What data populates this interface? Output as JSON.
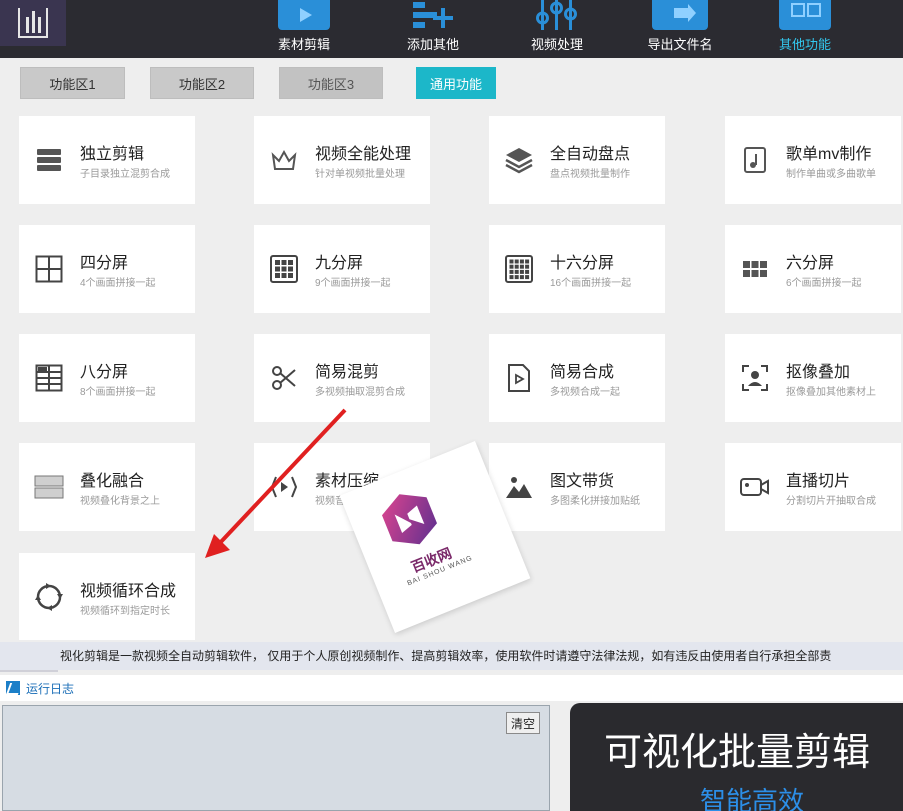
{
  "toolbar": {
    "items": [
      {
        "label": "素材剪辑",
        "icon": "play-icon"
      },
      {
        "label": "添加其他",
        "icon": "add-list-icon"
      },
      {
        "label": "视频处理",
        "icon": "sliders-icon"
      },
      {
        "label": "导出文件名",
        "icon": "export-icon"
      },
      {
        "label": "其他功能",
        "icon": "grid-icon"
      }
    ],
    "active_color": "#33c9f0"
  },
  "area_tabs": [
    "功能区1",
    "功能区2",
    "功能区3",
    "通用功能"
  ],
  "cards": [
    {
      "title": "独立剪辑",
      "sub": "子目录独立混剪合成",
      "icon": "stack-icon"
    },
    {
      "title": "视频全能处理",
      "sub": "针对单视频批量处理",
      "icon": "crown-icon"
    },
    {
      "title": "全自动盘点",
      "sub": "盘点视频批量制作",
      "icon": "layers-icon"
    },
    {
      "title": "歌单mv制作",
      "sub": "制作单曲或多曲歌单",
      "icon": "music-doc-icon"
    },
    {
      "title": "四分屏",
      "sub": "4个画面拼接一起",
      "icon": "grid-2x2-icon"
    },
    {
      "title": "九分屏",
      "sub": "9个画面拼接一起",
      "icon": "grid-3x3-icon"
    },
    {
      "title": "十六分屏",
      "sub": "16个画面拼接一起",
      "icon": "grid-4x4-icon"
    },
    {
      "title": "六分屏",
      "sub": "6个画面拼接一起",
      "icon": "grid-3x2-icon"
    },
    {
      "title": "八分屏",
      "sub": "8个画面拼接一起",
      "icon": "grid-2x4-icon"
    },
    {
      "title": "简易混剪",
      "sub": "多视频抽取混剪合成",
      "icon": "scissors-icon"
    },
    {
      "title": "简易合成",
      "sub": "多视频合成一起",
      "icon": "video-file-icon"
    },
    {
      "title": "抠像叠加",
      "sub": "抠像叠加其他素材上",
      "icon": "person-frame-icon"
    },
    {
      "title": "叠化融合",
      "sub": "视频叠化背景之上",
      "icon": "two-layers-icon"
    },
    {
      "title": "素材压缩",
      "sub": "视频音",
      "icon": "compress-icon"
    },
    {
      "title": "图文带货",
      "sub": "多图柔化拼接加贴纸",
      "icon": "image-icon"
    },
    {
      "title": "直播切片",
      "sub": "分割切片开抽取合成",
      "icon": "camera-icon"
    },
    {
      "title": "视频循环合成",
      "sub": "视频循环到指定时长",
      "icon": "loop-icon"
    }
  ],
  "notice": "视化剪辑是一款视频全自动剪辑软件， 仅用于个人原创视频制作、提高剪辑效率，使用软件时请遵守法律法规，如有违反由使用者自行承担全部责",
  "log": {
    "title": "运行日志",
    "clear_label": "清空"
  },
  "promo": {
    "line1": "可视化批量剪辑",
    "line2": "智能高效"
  },
  "watermark": {
    "name": "百收网",
    "sub": "BAI SHOU WANG"
  }
}
